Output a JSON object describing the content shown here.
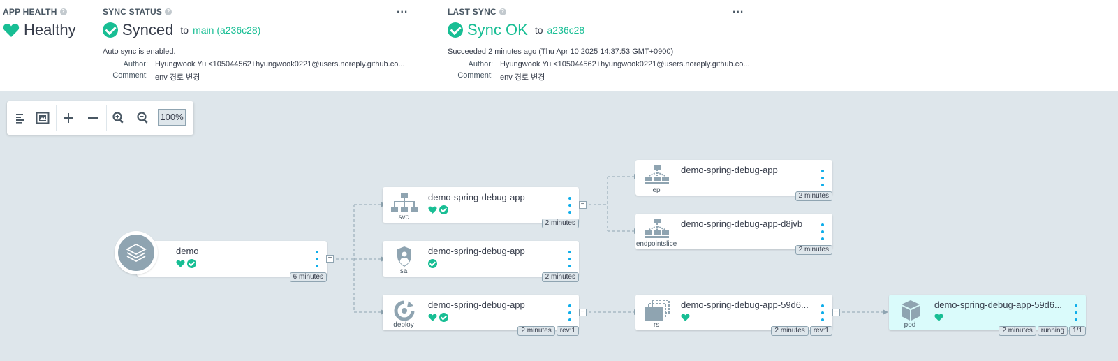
{
  "app_health": {
    "heading": "APP HEALTH",
    "status": "Healthy",
    "status_color": "#18be94"
  },
  "sync_status": {
    "heading": "SYNC STATUS",
    "status": "Synced",
    "to_text": "to",
    "revision": "main (a236c28)",
    "auto_sync": "Auto sync is enabled.",
    "author_label": "Author:",
    "author": "Hyungwook Yu <105044562+hyungwook0221@users.noreply.github.co...",
    "comment_label": "Comment:",
    "comment": "env 경로 변경"
  },
  "last_sync": {
    "heading": "LAST SYNC",
    "status": "Sync OK",
    "to_text": "to",
    "revision": "a236c28",
    "result": "Succeeded 2 minutes ago (Thu Apr 10 2025 14:37:53 GMT+0900)",
    "author_label": "Author:",
    "author": "Hyungwook Yu <105044562+hyungwook0221@users.noreply.github.co...",
    "comment_label": "Comment:",
    "comment": "env 경로 변경"
  },
  "more_label": "...",
  "toolbar": {
    "zoom": "100%",
    "icons": [
      "list-view-icon",
      "fit-view-icon",
      "expand-icon",
      "collapse-icon",
      "zoom-in-icon",
      "zoom-out-icon"
    ]
  },
  "tree": {
    "app": {
      "name": "demo",
      "age": "6 minutes"
    },
    "svc": {
      "name": "demo-spring-debug-app",
      "kind": "svc",
      "age": "2 minutes"
    },
    "sa": {
      "name": "demo-spring-debug-app",
      "kind": "sa",
      "age": "2 minutes"
    },
    "deploy": {
      "name": "demo-spring-debug-app",
      "kind": "deploy",
      "age": "2 minutes",
      "rev": "rev:1"
    },
    "ep": {
      "name": "demo-spring-debug-app",
      "kind": "ep",
      "age": "2 minutes"
    },
    "endpointslice": {
      "name": "demo-spring-debug-app-d8jvb",
      "kind": "endpointslice",
      "age": "2 minutes"
    },
    "rs": {
      "name": "demo-spring-debug-app-59d6...",
      "kind": "rs",
      "age": "2 minutes",
      "rev": "rev:1"
    },
    "pod": {
      "name": "demo-spring-debug-app-59d6...",
      "kind": "pod",
      "age": "2 minutes",
      "state": "running",
      "ready": "1/1"
    }
  },
  "collapse_label": "−",
  "colors": {
    "healthy": "#18be94",
    "accent_menu": "#0dadea",
    "canvas": "#dee6eb",
    "icon_gray": "#8fa4b1"
  }
}
